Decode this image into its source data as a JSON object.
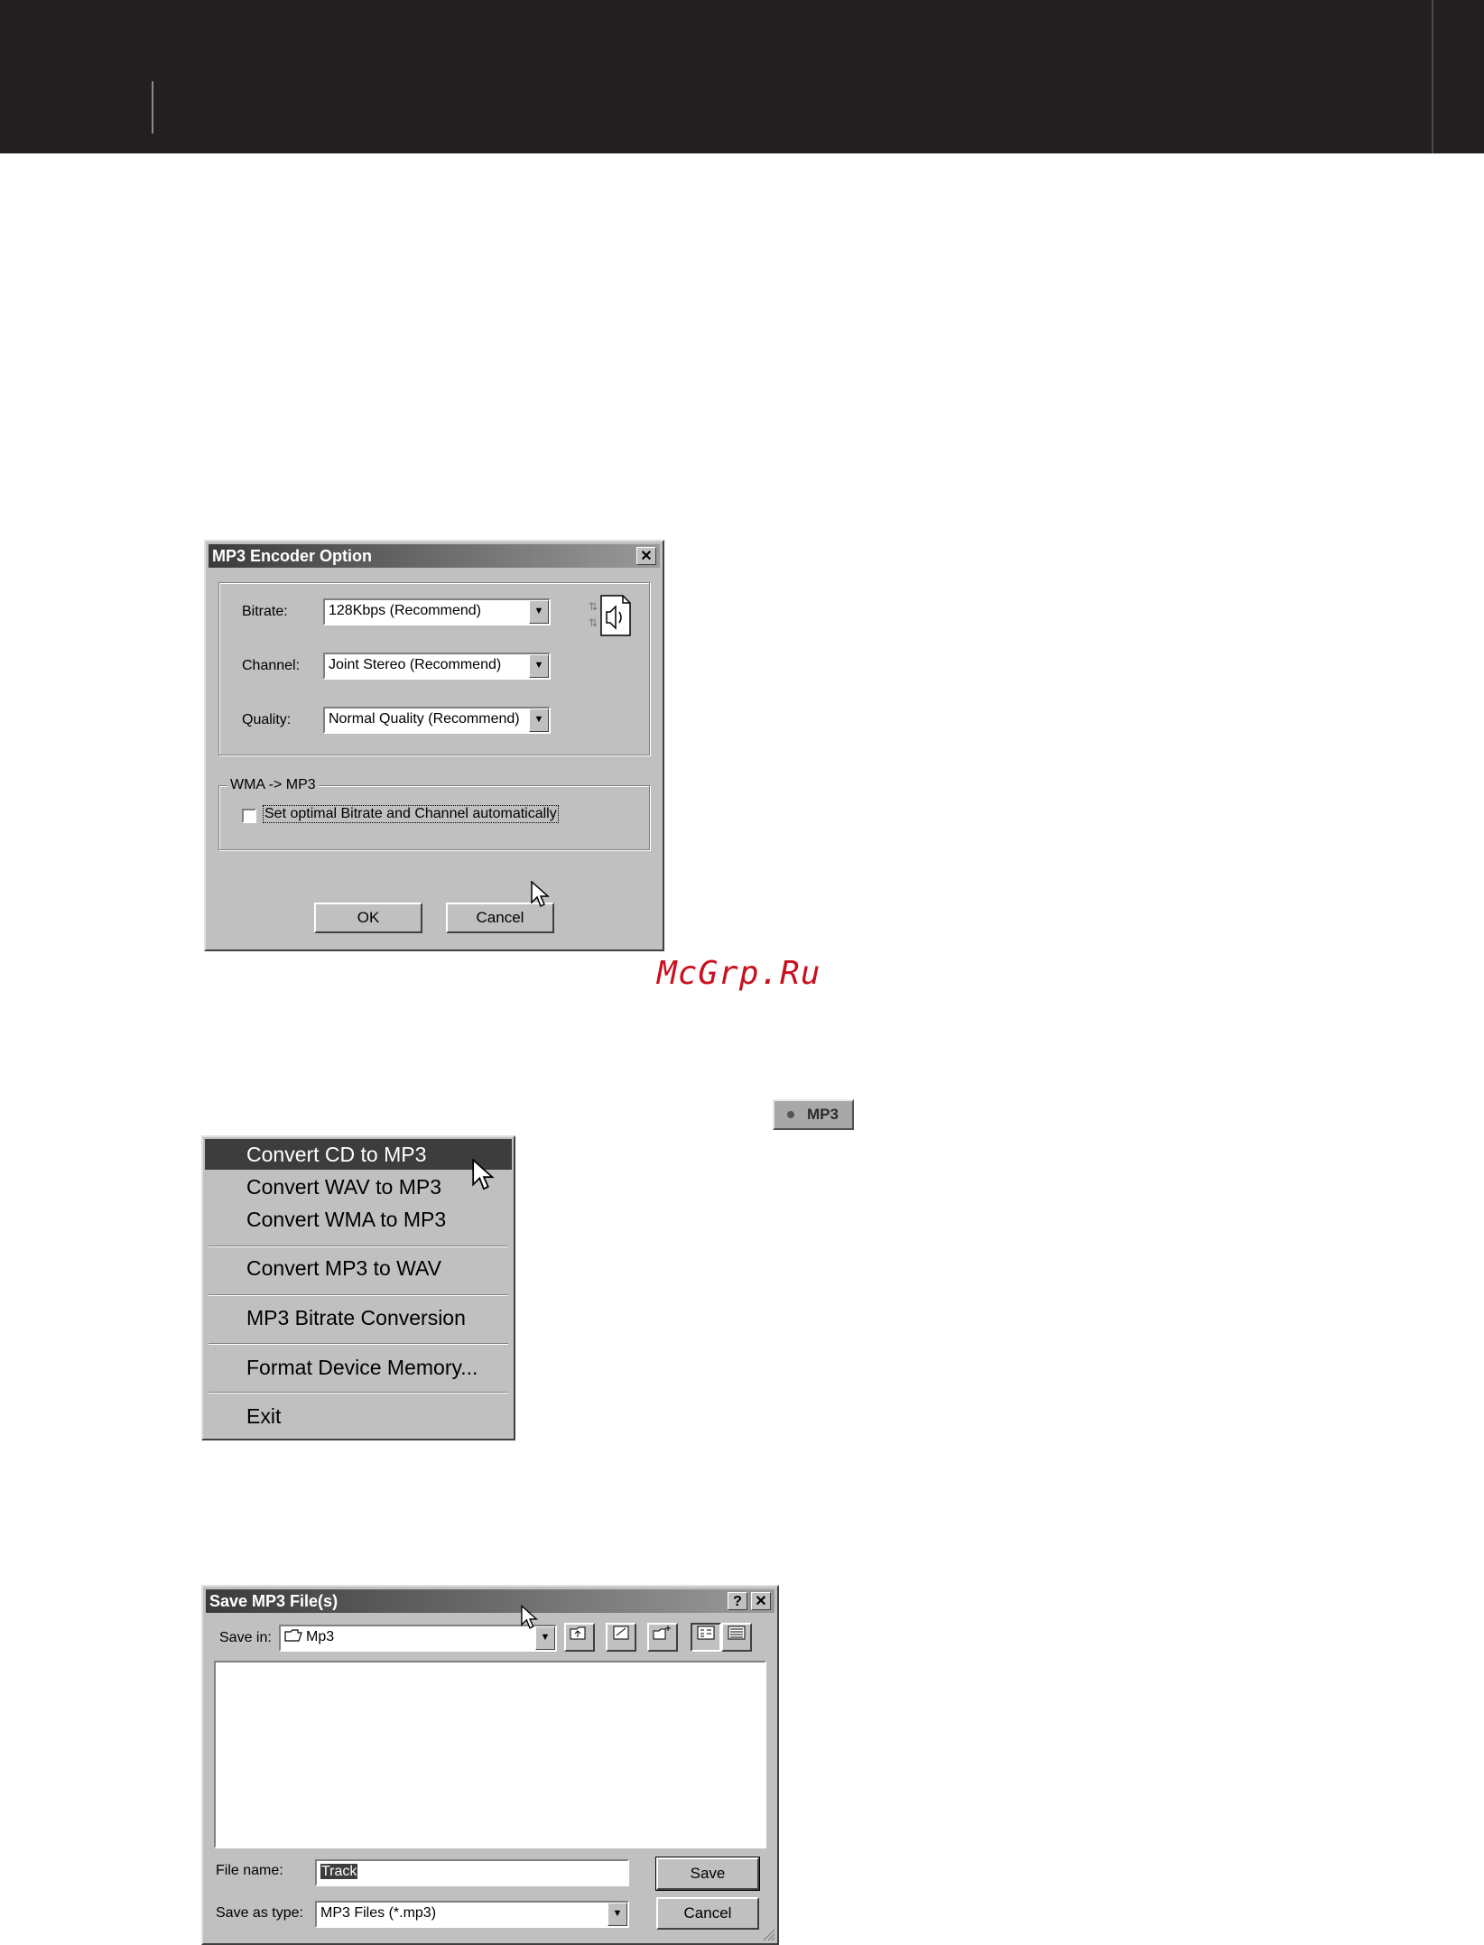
{
  "encoder_dialog": {
    "title": "MP3 Encoder Option",
    "close_label": "✕",
    "bitrate_label": "Bitrate:",
    "bitrate_value": "128Kbps (Recommend)",
    "channel_label": "Channel:",
    "channel_value": "Joint Stereo (Recommend)",
    "quality_label": "Quality:",
    "quality_value": "Normal Quality (Recommend)",
    "group_label": "WMA -> MP3",
    "checkbox_label": "Set optimal Bitrate and Channel automatically",
    "checkbox_checked": false,
    "ok_label": "OK",
    "cancel_label": "Cancel"
  },
  "watermark": "McGrp.Ru",
  "mp3_badge": "MP3",
  "context_menu": {
    "items": [
      {
        "label": "Convert CD to MP3",
        "selected": true
      },
      {
        "label": "Convert WAV to MP3"
      },
      {
        "label": "Convert WMA to MP3"
      },
      {
        "label": "Convert MP3 to WAV"
      },
      {
        "label": "MP3 Bitrate Conversion"
      },
      {
        "label": "Format Device Memory..."
      },
      {
        "label": "Exit"
      }
    ]
  },
  "save_dialog": {
    "title": "Save MP3 File(s)",
    "help_label": "?",
    "close_label": "✕",
    "save_in_label": "Save in:",
    "save_in_value": "Mp3",
    "file_name_label": "File name:",
    "file_name_value": "Track",
    "save_as_type_label": "Save as type:",
    "save_as_type_value": "MP3 Files (*.mp3)",
    "save_label": "Save",
    "cancel_label": "Cancel"
  }
}
